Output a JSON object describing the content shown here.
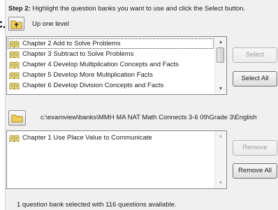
{
  "step": {
    "label": "Step 2:",
    "instruction": "Highlight the question banks you want to use and click the Select button."
  },
  "navigation": {
    "up_one_level": "Up one level"
  },
  "available_banks": {
    "items": [
      {
        "label": "Chapter 2 Add to Solve Problems",
        "focused": true
      },
      {
        "label": "Chapter 3 Subtract to Solve Problems"
      },
      {
        "label": "Chapter 4 Develop Multiplication Concepts and Facts"
      },
      {
        "label": "Chapter 5 Develop More Multiplication Facts"
      },
      {
        "label": "Chapter 6 Develop Division Concepts and Facts"
      }
    ]
  },
  "buttons": {
    "select": "Select",
    "select_all": "Select All",
    "remove": "Remove",
    "remove_all": "Remove All"
  },
  "folder": {
    "path": "c:\\examview\\banks\\MMH MA NAT Math Connects 3-6 09\\Grade 3\\English"
  },
  "selected_banks": {
    "items": [
      {
        "label": "Chapter 1 Use Place Value to Communicate"
      }
    ]
  },
  "status": {
    "text": "1 question bank selected with 116 questions available."
  },
  "colors": {
    "dialog_background": "#f0f0f0",
    "list_background": "#ffffff",
    "folder_yellow": "#f2cf5b",
    "disabled_text": "#9a9a9a"
  },
  "icons": {
    "up_one_level": "folder-up-icon",
    "folder": "folder-icon",
    "question_bank": "question-bank-book-icon"
  }
}
